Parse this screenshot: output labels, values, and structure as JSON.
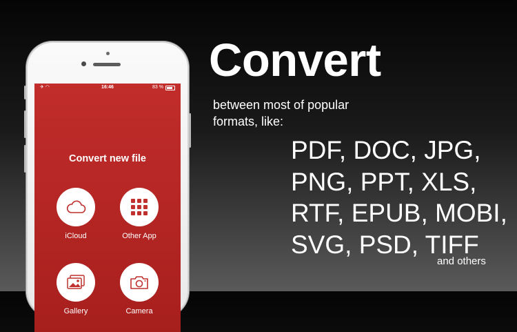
{
  "headline": "Convert",
  "subtitle": {
    "line1": "between most of popular",
    "line2": "formats, like:"
  },
  "formats": [
    "PDF, DOC, JPG,",
    "PNG, PPT, XLS,",
    "RTF, EPUB, MOBI,",
    "SVG, PSD, TIFF"
  ],
  "others": "and others",
  "phone": {
    "status_bar": {
      "time": "16:46",
      "battery": "83 %"
    },
    "screen_title": "Convert new file",
    "tiles": [
      {
        "label": "iCloud",
        "icon": "cloud-icon"
      },
      {
        "label": "Other App",
        "icon": "app-grid-icon"
      },
      {
        "label": "Gallery",
        "icon": "photos-icon"
      },
      {
        "label": "Camera",
        "icon": "camera-icon"
      }
    ]
  },
  "colors": {
    "accent_red": "#b82624",
    "icon_red": "#c0302e",
    "text": "#ffffff"
  }
}
